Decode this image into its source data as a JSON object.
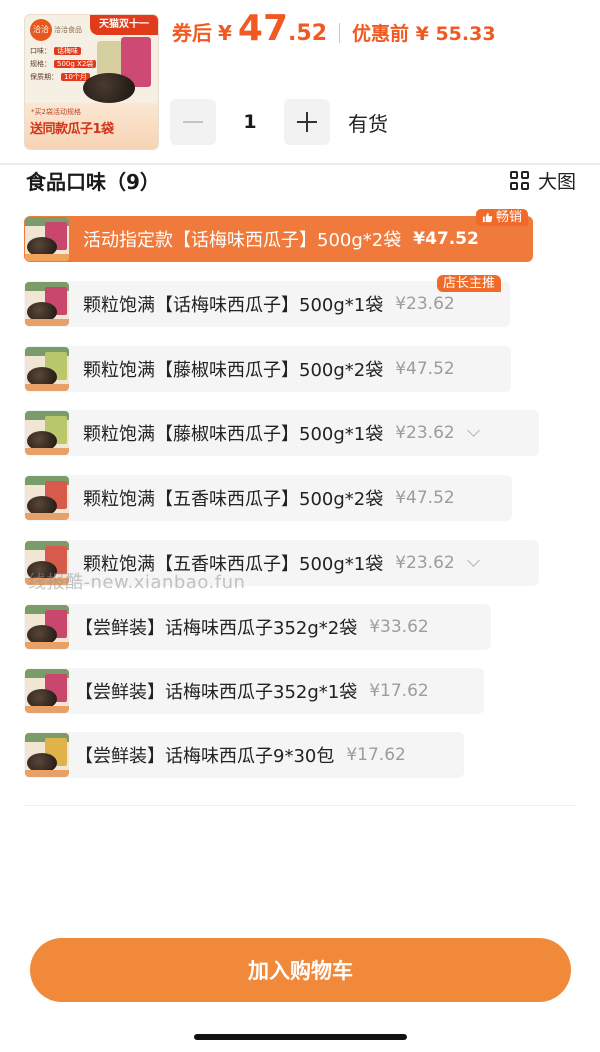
{
  "header": {
    "thumbnail": {
      "banner": "天猫双十一",
      "logo": "洽洽",
      "brand_text": "洽洽食品",
      "spec_lines": [
        {
          "label": "口味：",
          "value": "话梅味"
        },
        {
          "label": "规格：",
          "value": "500g X2袋"
        },
        {
          "label": "保质期：",
          "value": "10个月"
        }
      ],
      "band_small": "*买2袋活动规格",
      "band_big": "送同款瓜子1袋"
    },
    "coupon_label": "券后",
    "currency": "¥",
    "price_int": "47",
    "price_dec": ".52",
    "original_label": "优惠前 ¥ 55.33",
    "quantity": "1",
    "stock": "有货"
  },
  "section": {
    "title": "食品口味（9）",
    "big_view_label": "大图"
  },
  "options": [
    {
      "label": "活动指定款【话梅味西瓜子】500g*2袋",
      "price": "¥47.52",
      "selected": true,
      "tag": "畅销"
    },
    {
      "label": "颗粒饱满【话梅味西瓜子】500g*1袋",
      "price": "¥23.62",
      "selected": false,
      "tag": "店长主推"
    },
    {
      "label": "颗粒饱满【藤椒味西瓜子】500g*2袋",
      "price": "¥47.52",
      "selected": false
    },
    {
      "label": "颗粒饱满【藤椒味西瓜子】500g*1袋",
      "price": "¥23.62",
      "selected": false,
      "expandable": true
    },
    {
      "label": "颗粒饱满【五香味西瓜子】500g*2袋",
      "price": "¥47.52",
      "selected": false
    },
    {
      "label": "颗粒饱满【五香味西瓜子】500g*1袋",
      "price": "¥23.62",
      "selected": false,
      "expandable": true
    },
    {
      "label": "【尝鲜装】话梅味西瓜子352g*2袋",
      "price": "¥33.62",
      "selected": false
    },
    {
      "label": "【尝鲜装】话梅味西瓜子352g*1袋",
      "price": "¥17.62",
      "selected": false
    },
    {
      "label": "【尝鲜装】话梅味西瓜子9*30包",
      "price": "¥17.62",
      "selected": false
    }
  ],
  "watermark": "线报酷-new.xianbao.fun",
  "cta": {
    "label": "加入购物车"
  },
  "colors": {
    "accent": "#f05a22",
    "selected_bg": "#f07a3b",
    "cta": "#f08a3a",
    "tag": "#f06a2a"
  },
  "icons": [
    "minus-icon",
    "plus-icon",
    "grid-icon",
    "thumbs-up-icon",
    "chevron-down-icon"
  ]
}
